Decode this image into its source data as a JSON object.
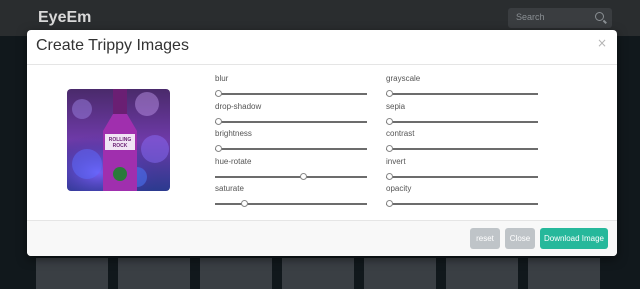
{
  "app": {
    "logo": "EyeEm",
    "search_placeholder": "Search"
  },
  "modal": {
    "title": "Create Trippy Images",
    "close": "×",
    "preview_label": "ROLLING ROCK"
  },
  "filters": [
    {
      "label": "blur",
      "value": 0
    },
    {
      "label": "grayscale",
      "value": 0
    },
    {
      "label": "drop-shadow",
      "value": 0
    },
    {
      "label": "sepia",
      "value": 0
    },
    {
      "label": "brightness",
      "value": 0
    },
    {
      "label": "contrast",
      "value": 0
    },
    {
      "label": "hue-rotate",
      "value": 58
    },
    {
      "label": "invert",
      "value": 0
    },
    {
      "label": "saturate",
      "value": 18
    },
    {
      "label": "opacity",
      "value": 0
    }
  ],
  "buttons": {
    "reset": "reset",
    "close": "Close",
    "download": "Download Image"
  },
  "colors": {
    "accent": "#26b89b",
    "button_gray": "#bfc4c8",
    "topbar": "#2a2d2f"
  }
}
